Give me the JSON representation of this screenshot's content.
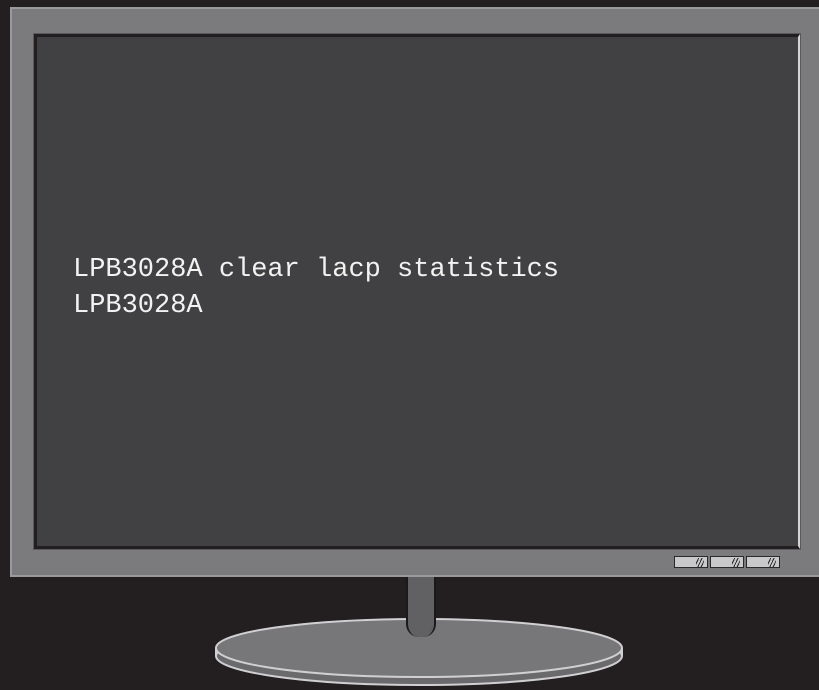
{
  "terminal": {
    "lines": [
      "LPB3028A clear lacp statistics",
      "LPB3028A"
    ]
  },
  "monitor": {
    "control_buttons": [
      {
        "icon": "monitor-button-icon"
      },
      {
        "icon": "monitor-button-icon"
      },
      {
        "icon": "monitor-button-icon"
      }
    ]
  },
  "colors": {
    "background": "#231f20",
    "bezel": "#7b7b7d",
    "screen": "#414042",
    "text": "#f2f2f2",
    "stand": "#616163"
  }
}
